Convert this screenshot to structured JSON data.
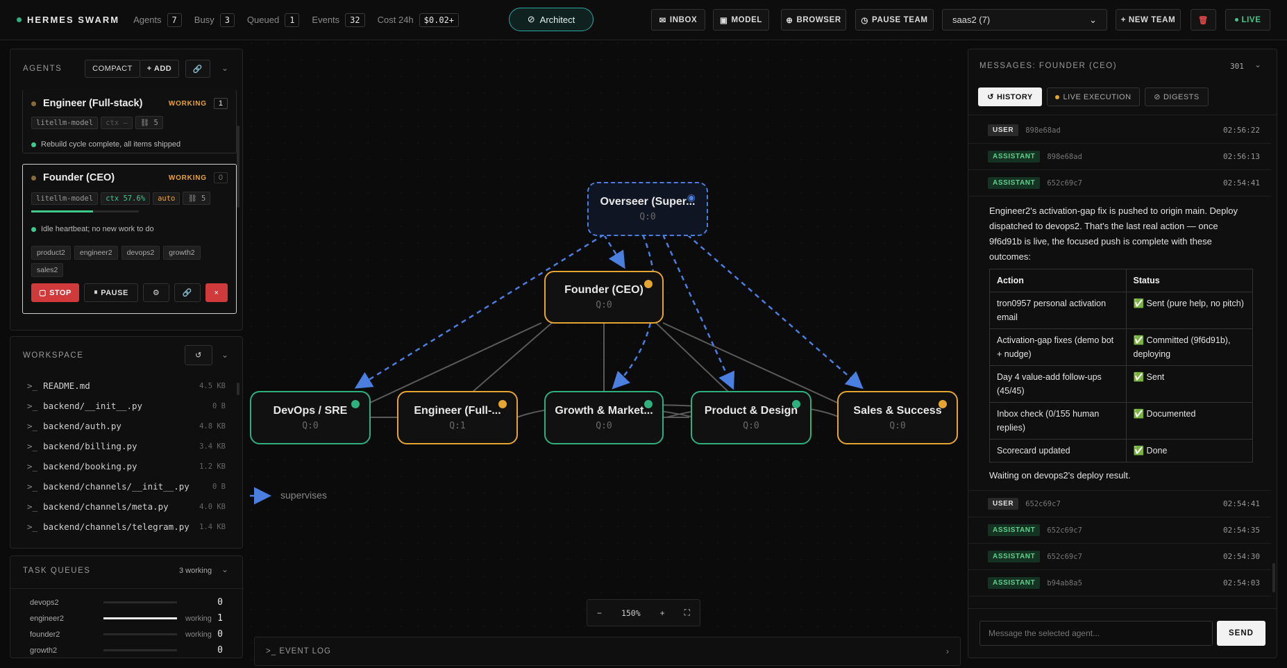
{
  "topbar": {
    "brand": "HERMES SWARM",
    "stats": [
      {
        "label": "Agents",
        "value": "7"
      },
      {
        "label": "Busy",
        "value": "3"
      },
      {
        "label": "Queued",
        "value": "1"
      },
      {
        "label": "Events",
        "value": "32"
      },
      {
        "label": "Cost 24h",
        "value": "$0.02+"
      }
    ],
    "architect_label": "Architect",
    "buttons": {
      "inbox": "INBOX",
      "model": "MODEL",
      "browser": "BROWSER",
      "pause_team": "PAUSE TEAM",
      "new_team": "+ NEW TEAM",
      "live": "LIVE"
    },
    "team_select": "saas2 (7)"
  },
  "agents_panel": {
    "title": "AGENTS",
    "compact_label": "COMPACT",
    "add_label": "+ ADD",
    "cards": [
      {
        "name": "Engineer (Full-stack)",
        "status": "WORKING",
        "queue": "1",
        "tags": [
          "litellm-model",
          "ctx –",
          "5"
        ],
        "note": "Rebuild cycle complete, all items shipped"
      },
      {
        "name": "Founder (CEO)",
        "status": "WORKING",
        "queue": "0",
        "tags": [
          "litellm-model",
          "ctx 57.6%",
          "auto",
          "5"
        ],
        "ctx_fraction": 0.576,
        "note": "Idle heartbeat; no new work to do",
        "chips": [
          "product2",
          "engineer2",
          "devops2",
          "growth2",
          "sales2"
        ],
        "stop_label": "STOP",
        "pause_label": "PAUSE",
        "delete_label": "×"
      }
    ]
  },
  "workspace": {
    "title": "WORKSPACE",
    "files": [
      {
        "name": "README.md",
        "size": "4.5 KB"
      },
      {
        "name": "backend/__init__.py",
        "size": "0 B"
      },
      {
        "name": "backend/auth.py",
        "size": "4.8 KB"
      },
      {
        "name": "backend/billing.py",
        "size": "3.4 KB"
      },
      {
        "name": "backend/booking.py",
        "size": "1.2 KB"
      },
      {
        "name": "backend/channels/__init__.py",
        "size": "0 B"
      },
      {
        "name": "backend/channels/meta.py",
        "size": "4.0 KB"
      },
      {
        "name": "backend/channels/telegram.py",
        "size": "1.4 KB"
      }
    ]
  },
  "task_queues": {
    "title": "TASK QUEUES",
    "summary": "3 working",
    "rows": [
      {
        "name": "devops2",
        "state": "",
        "value": "0",
        "fill": 0
      },
      {
        "name": "engineer2",
        "state": "working",
        "value": "1",
        "fill": 1
      },
      {
        "name": "founder2",
        "state": "working",
        "value": "0",
        "fill": 0
      },
      {
        "name": "growth2",
        "state": "",
        "value": "0",
        "fill": 0
      }
    ]
  },
  "graph": {
    "nodes": [
      {
        "id": "overseer",
        "name": "Overseer (Super...",
        "queue": "Q:0"
      },
      {
        "id": "founder",
        "name": "Founder (CEO)",
        "queue": "Q:0"
      },
      {
        "id": "devops",
        "name": "DevOps / SRE",
        "queue": "Q:0"
      },
      {
        "id": "engineer",
        "name": "Engineer (Full-...",
        "queue": "Q:1"
      },
      {
        "id": "growth",
        "name": "Growth & Market...",
        "queue": "Q:0"
      },
      {
        "id": "product",
        "name": "Product & Design",
        "queue": "Q:0"
      },
      {
        "id": "sales",
        "name": "Sales & Success",
        "queue": "Q:0"
      }
    ],
    "legend": "supervises",
    "zoom": "150%",
    "event_log_label": "EVENT LOG",
    "colors": {
      "supervises": "#4a7fe0",
      "active": "#e5a531",
      "idle": "#2eb07f"
    }
  },
  "messages": {
    "title": "MESSAGES: FOUNDER (CEO)",
    "count": "301",
    "tabs": [
      "HISTORY",
      "LIVE EXECUTION",
      "DIGESTS"
    ],
    "rows_top": [
      {
        "role": "USER",
        "id": "898e68ad",
        "time": "02:56:22"
      },
      {
        "role": "ASSISTANT",
        "id": "898e68ad",
        "time": "02:56:13"
      },
      {
        "role": "ASSISTANT",
        "id": "652c69c7",
        "time": "02:54:41"
      }
    ],
    "body_intro": "Engineer2's activation-gap fix is pushed to origin main. Deploy dispatched to devops2. That's the last real action — once 9f6d91b is live, the focused push is complete with these outcomes:",
    "table_headers": [
      "Action",
      "Status"
    ],
    "table_rows": [
      [
        "tron0957 personal activation email",
        "✅ Sent (pure help, no pitch)"
      ],
      [
        "Activation-gap fixes (demo bot + nudge)",
        "✅ Committed (9f6d91b), deploying"
      ],
      [
        "Day 4 value-add follow-ups (45/45)",
        "✅ Sent"
      ],
      [
        "Inbox check (0/155 human replies)",
        "✅ Documented"
      ],
      [
        "Scorecard updated",
        "✅ Done"
      ]
    ],
    "body_outro": "Waiting on devops2's deploy result.",
    "rows_bottom": [
      {
        "role": "USER",
        "id": "652c69c7",
        "time": "02:54:41"
      },
      {
        "role": "ASSISTANT",
        "id": "652c69c7",
        "time": "02:54:35"
      },
      {
        "role": "ASSISTANT",
        "id": "652c69c7",
        "time": "02:54:30"
      },
      {
        "role": "ASSISTANT",
        "id": "b94ab8a5",
        "time": "02:54:03"
      }
    ],
    "input_placeholder": "Message the selected agent...",
    "send_label": "SEND"
  }
}
